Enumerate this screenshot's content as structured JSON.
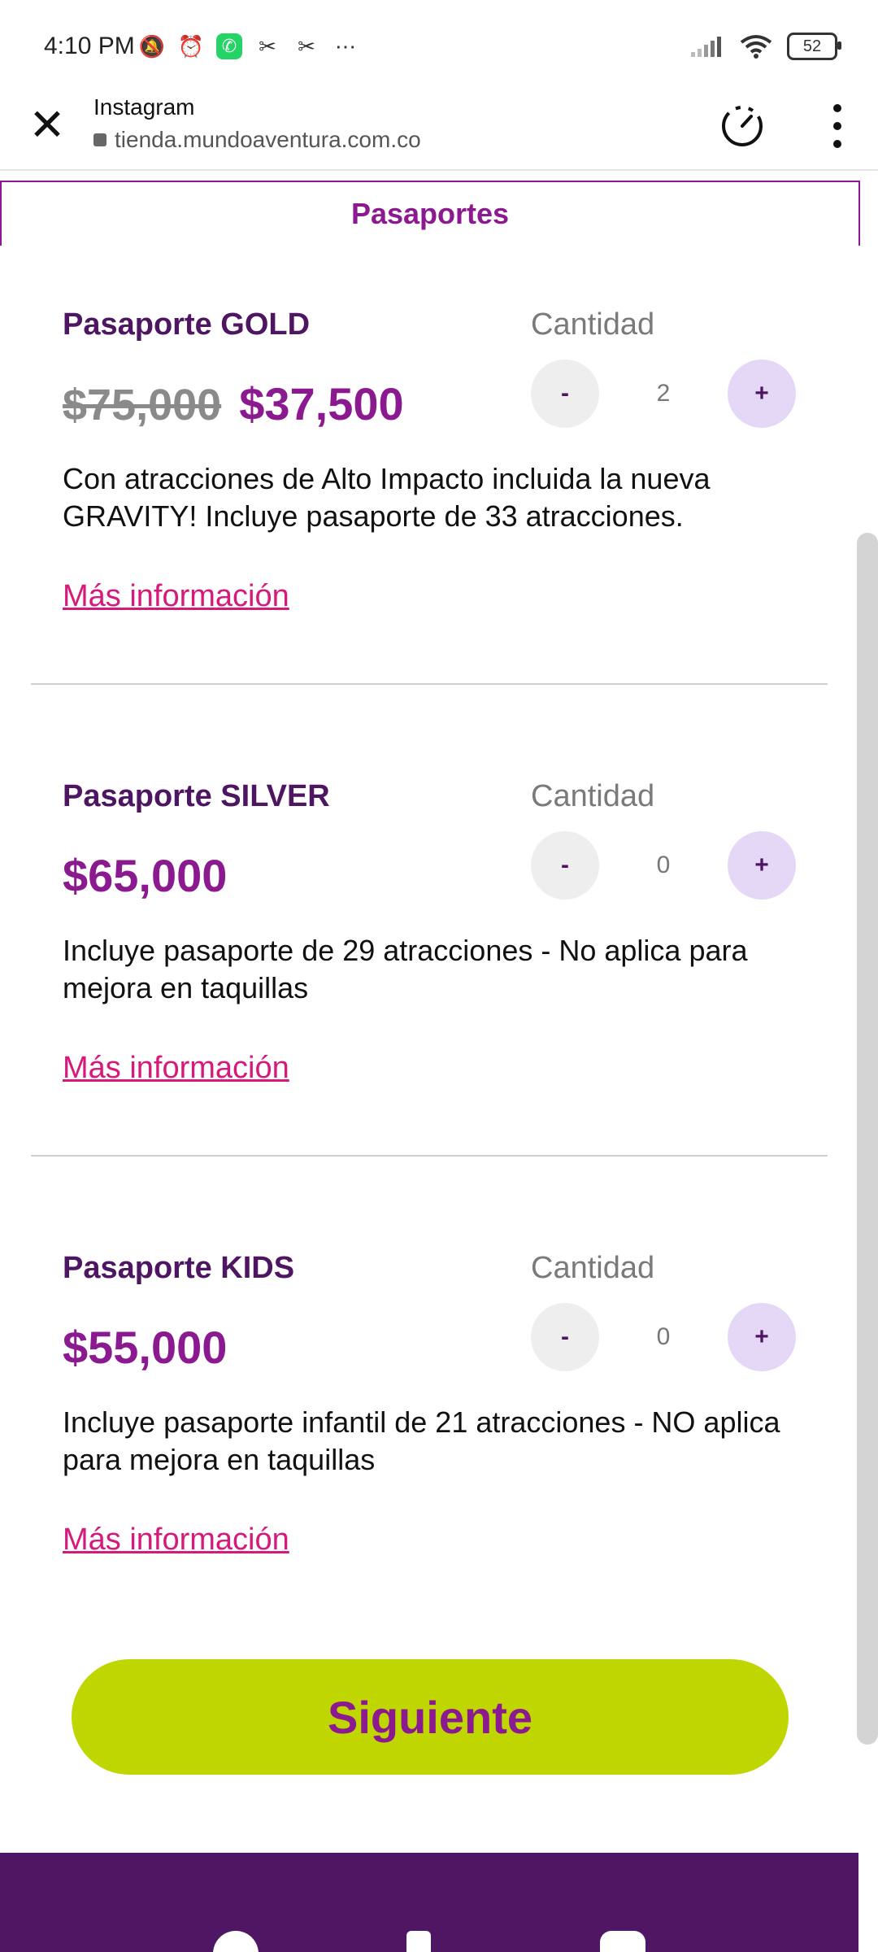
{
  "status_bar": {
    "time": "4:10 PM",
    "battery": "52"
  },
  "browser": {
    "app_title": "Instagram",
    "url": "tienda.mundoaventura.com.co"
  },
  "tab": {
    "label": "Pasaportes"
  },
  "products": [
    {
      "name": "Pasaporte GOLD",
      "old_price": "$75,000",
      "price": "$37,500",
      "qty_label": "Cantidad",
      "minus": "-",
      "plus": "+",
      "quantity": "2",
      "description": "Con atracciones de Alto Impacto incluida la nueva GRAVITY! Incluye pasaporte de 33 atracciones.",
      "more_link": "Más información"
    },
    {
      "name": "Pasaporte SILVER",
      "price": "$65,000",
      "qty_label": "Cantidad",
      "minus": "-",
      "plus": "+",
      "quantity": "0",
      "description": "Incluye pasaporte de 29 atracciones - No aplica para mejora en taquillas",
      "more_link": "Más información"
    },
    {
      "name": "Pasaporte KIDS",
      "price": "$55,000",
      "qty_label": "Cantidad",
      "minus": "-",
      "plus": "+",
      "quantity": "0",
      "description": "Incluye pasaporte infantil de 21 atracciones - NO aplica para mejora en taquillas",
      "more_link": "Más información"
    }
  ],
  "cta": {
    "label": "Siguiente"
  },
  "colors": {
    "brand_purple": "#8b1a90",
    "dark_purple": "#4e1563",
    "cta_green": "#bfd600",
    "link_pink": "#d6197a",
    "footer_bg": "#4f1763"
  }
}
